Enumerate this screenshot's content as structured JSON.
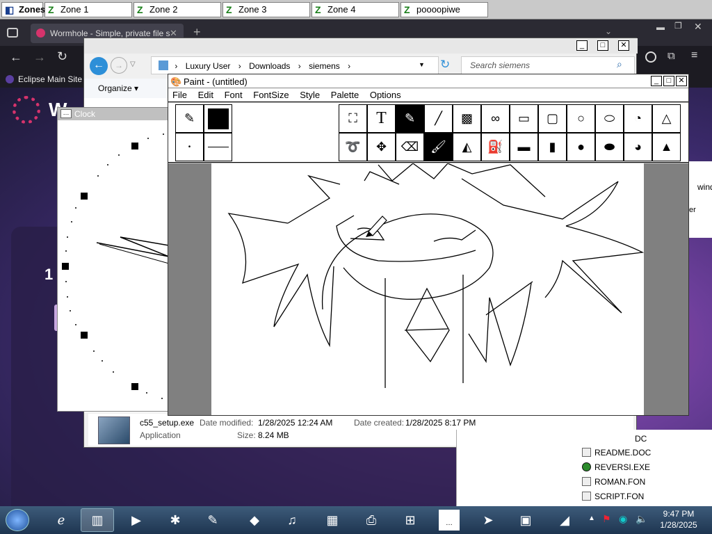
{
  "zones_bar": {
    "zones_label": "Zones",
    "tabs": [
      {
        "label": "Zone 1"
      },
      {
        "label": "Zone 2"
      },
      {
        "label": "Zone 3"
      },
      {
        "label": "Zone 4"
      },
      {
        "label": "poooopiwe"
      }
    ]
  },
  "browser": {
    "tab_title": "Wormhole - Simple, private file s",
    "bookmark": "Eclipse Main Site",
    "page_char": "W",
    "page_number": "1",
    "side_text_1": "wind",
    "side_text_2": "er"
  },
  "explorer": {
    "breadcrumb": [
      "Luxury User",
      "Downloads",
      "siemens"
    ],
    "search_placeholder": "Search siemens",
    "organize_label": "Organize",
    "details": {
      "filename": "c55_setup.exe",
      "type": "Application",
      "date_modified_label": "Date modified:",
      "date_modified": "1/28/2025 12:24 AM",
      "date_created_label": "Date created:",
      "date_created": "1/28/2025 8:17 PM",
      "size_label": "Size:",
      "size": "8.24 MB"
    }
  },
  "clock": {
    "title": "Clock"
  },
  "paint": {
    "title": "Paint - (untitled)",
    "menu": [
      "File",
      "Edit",
      "Font",
      "FontSize",
      "Style",
      "Palette",
      "Options"
    ]
  },
  "file_list": {
    "items": [
      {
        "name": "README.DOC",
        "partial": "DC"
      },
      {
        "name": "REVERSI.EXE"
      },
      {
        "name": "ROMAN.FON"
      },
      {
        "name": "SCRIPT.FON"
      }
    ]
  },
  "taskbar": {
    "time": "9:47 PM",
    "date": "1/28/2025"
  },
  "colors": {
    "zone_icon": "#1a7f1a",
    "taskbar_top": "#3d5b7a",
    "taskbar_bottom": "#1e3550",
    "explorer_nav": "#2d8fd8"
  }
}
